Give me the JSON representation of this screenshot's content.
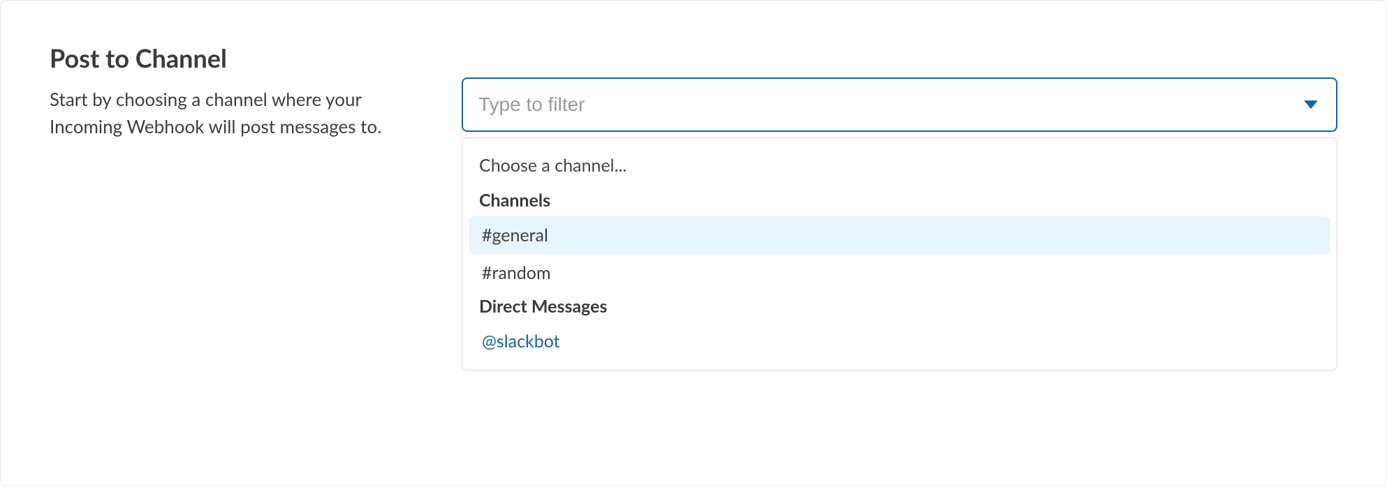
{
  "section": {
    "heading": "Post to Channel",
    "description": "Start by choosing a channel where your Incoming Webhook will post messages to."
  },
  "select": {
    "placeholder": "Type to filter",
    "value": ""
  },
  "dropdown": {
    "prompt": "Choose a channel...",
    "groups": [
      {
        "label": "Channels",
        "options": [
          {
            "text": "#general",
            "highlighted": true
          },
          {
            "text": "#random",
            "highlighted": false
          }
        ]
      },
      {
        "label": "Direct Messages",
        "options": [
          {
            "text": "@slackbot",
            "highlighted": false,
            "dm": true
          }
        ]
      }
    ]
  },
  "colors": {
    "focus_border": "#1264a3",
    "highlight_bg": "#e8f5fa",
    "link": "#1264a3"
  }
}
